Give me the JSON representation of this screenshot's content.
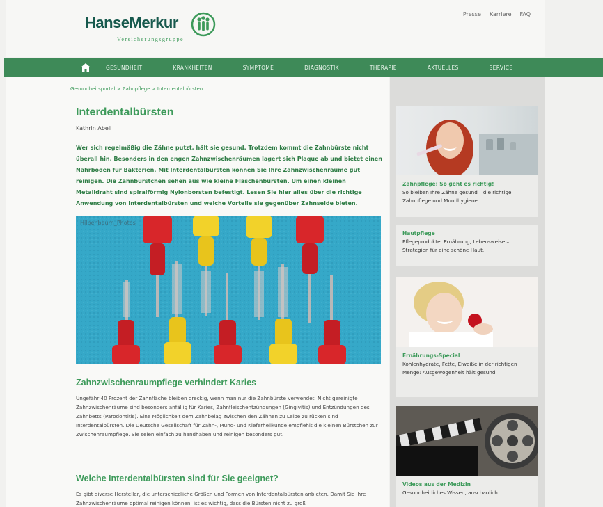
{
  "header": {
    "logo_name": "HanseMerkur",
    "logo_tagline": "Versicherungsgruppe",
    "meta_links": [
      "Presse",
      "Karriere",
      "FAQ"
    ]
  },
  "nav": {
    "items": [
      "GESUNDHEIT",
      "KRANKHEITEN",
      "SYMPTOME",
      "DIAGNOSTIK",
      "THERAPIE",
      "AKTUELLES",
      "SERVICE"
    ]
  },
  "article": {
    "breadcrumb": "Gesundheitsportal > Zahnpflege > Interdentalbürsten",
    "title": "Interdentalbürsten",
    "author": "Kathrin Abeli",
    "intro": "Wer sich regelmäßig die Zähne putzt, hält sie gesund. Trotzdem kommt die Zahnbürste nicht überall hin. Besonders in den engen Zahnzwischenräumen lagert sich Plaque ab und bietet einen Nährboden für Bakterien. Mit Interdentalbürsten können Sie Ihre Zahnzwischenräume gut reinigen. Die Zahnbürstchen sehen aus wie kleine Flaschenbürsten. Um einen kleinen Metalldraht sind spiralförmig Nylonborsten befestigt. Lesen Sie hier alles über die richtige Anwendung von Interdentalbürsten und welche Vorteile sie gegenüber Zahnseide bieten.",
    "hero_credit": "Hilbenbeurn_Photos",
    "section1_heading": "Zahnzwischenraumpflege verhindert Karies",
    "section1_text": "Ungefähr 40 Prozent der Zahnfläche bleiben dreckig, wenn man nur die Zahnbürste verwendet. Nicht gereinigte Zahnzwischenräume sind besonders anfällig für Karies, Zahnfleischentzündungen (Gingivitis) und Entzündungen des Zahnbetts (Parodontitis). Eine Möglichkeit dem Zahnbelag zwischen den Zähnen zu Leibe zu rücken sind Interdentalbürsten. Die Deutsche Gesellschaft für Zahn-, Mund- und Kieferheilkunde empfiehlt die kleinen Bürstchen zur Zwischenraumpflege. Sie seien einfach zu handhaben und reinigen besonders gut.",
    "section2_heading": "Welche Interdentalbürsten sind für Sie geeignet?",
    "section2_text": "Es gibt diverse Hersteller, die unterschiedliche Größen und Formen von Interdentalbürsten anbieten. Damit Sie Ihre Zahnzwischenräume optimal reinigen können, ist es wichtig, dass die Bürsten nicht zu groß"
  },
  "sidebar": {
    "cards": [
      {
        "title": "Zahnpflege: So geht es richtig!",
        "text": "So bleiben Ihre Zähne gesund – die richtige Zahnpflege und Mundhygiene."
      },
      {
        "title": "Hautpflege",
        "text": "Pflegeprodukte, Ernährung, Lebensweise – Strategien für eine schöne Haut."
      },
      {
        "title": "Ernährungs-Special",
        "text": "Kohlenhydrate, Fette, Eiweiße in der richtigen Menge: Ausgewogenheit hält gesund."
      },
      {
        "title": "Videos aus der Medizin",
        "text": "Gesundheitliches Wissen, anschaulich"
      }
    ]
  },
  "colors": {
    "brand_green": "#3e8a58",
    "accent_green": "#3d9a5a",
    "dark_green": "#17594d"
  }
}
